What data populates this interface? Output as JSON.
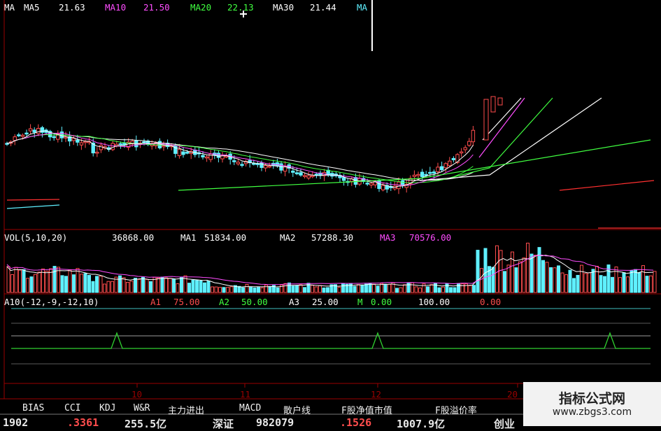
{
  "colors": {
    "up": "#ff4d4d",
    "down": "#5ff0ff",
    "ma5": "#ffffff",
    "ma10": "#ff4dff",
    "ma20": "#40ff40",
    "ma30": "#ffffff",
    "grid": "#9a0000",
    "a10_line": "#30d030"
  },
  "price_legend": {
    "label": "MA",
    "ma5_label": "MA5",
    "ma5_value": "21.63",
    "ma10_label": "MA10",
    "ma10_value": "21.50",
    "ma20_label": "MA20",
    "ma20_value": "22.13",
    "ma30_label": "MA30",
    "ma30_value": "21.44",
    "trailing": "MA"
  },
  "vol_legend": {
    "label": "VOL(5,10,20)",
    "value": "36868.00",
    "ma1_label": "MA1",
    "ma1_value": "51834.00",
    "ma2_label": "MA2",
    "ma2_value": "57288.30",
    "ma3_label": "MA3",
    "ma3_value": "70576.00"
  },
  "a10_legend": {
    "label": "A10(-12,-9,-12,10)",
    "a1_label": "A1",
    "a1_value": "75.00",
    "a2_label": "A2",
    "a2_value": "50.00",
    "a3_label": "A3",
    "a3_value": "25.00",
    "m_label": "M",
    "m_value": "0.00",
    "value_100": "100.00",
    "value_0": "0.00"
  },
  "axis": {
    "month_labels": [
      "10",
      "11",
      "12",
      "20"
    ]
  },
  "indicator_tabs": [
    "BIAS",
    "CCI",
    "KDJ",
    "W&R",
    "主力进出",
    "MACD",
    "散户线",
    "F股净值市值",
    "F股溢价率"
  ],
  "status_bar": {
    "item1": "1902",
    "item2": ".3361",
    "item3": "255.5亿",
    "item4": "深证",
    "item5": "982079",
    "item6": ".1526",
    "item7": "1007.9亿",
    "item8": "创业"
  },
  "watermark": {
    "title": "指标公式网",
    "url": "www.zbgs3.com"
  },
  "chart_data": {
    "type": "candlestick",
    "title": "",
    "series": [
      {
        "name": "MA5",
        "value": 21.63
      },
      {
        "name": "MA10",
        "value": 21.5
      },
      {
        "name": "MA20",
        "value": 22.13
      },
      {
        "name": "MA30",
        "value": 21.44
      }
    ],
    "volume": {
      "value": 36868.0,
      "ma1": 51834.0,
      "ma2": 57288.3,
      "ma3": 70576.0
    },
    "indicator": {
      "name": "A10",
      "params": [
        -12,
        -9,
        -12,
        10
      ],
      "A1": 75.0,
      "A2": 50.0,
      "A3": 25.0,
      "M": 0.0,
      "levels": [
        100,
        75,
        50,
        25,
        0
      ],
      "signal_spikes": 3
    },
    "x_tick_labels": [
      "10",
      "11",
      "12",
      "20"
    ],
    "grid": false
  }
}
